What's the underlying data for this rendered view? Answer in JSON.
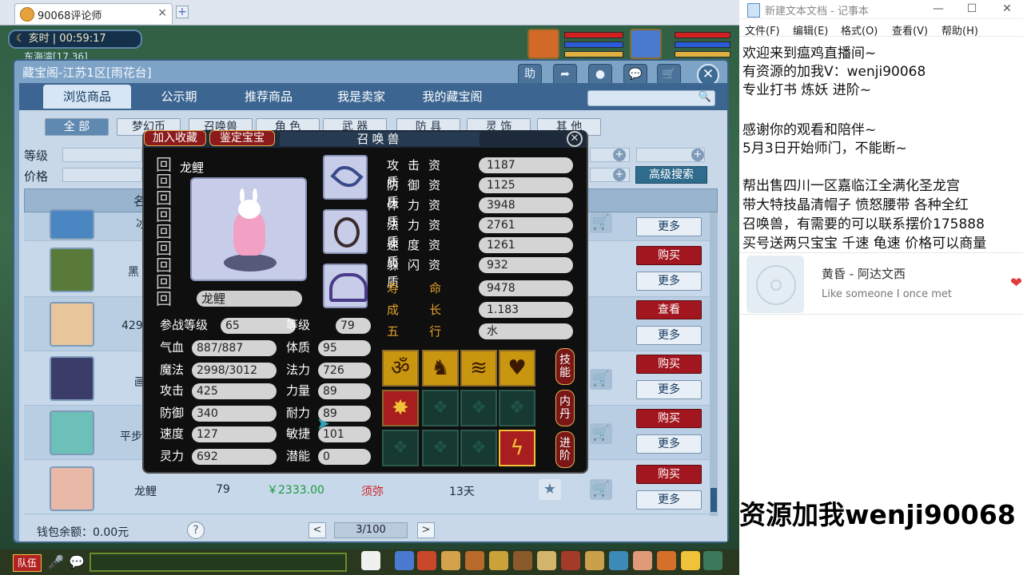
{
  "browser": {
    "tab_title": "90068评论师",
    "close": "×",
    "new_tab": "+"
  },
  "hud": {
    "clock": "亥时 | 00:59:17",
    "map": "东海湾[17,36]"
  },
  "dialog": {
    "title": "藏宝阁-江苏1区[雨花台]",
    "top_icons": {
      "help": "助",
      "share": "➦",
      "record": "●",
      "chat": "💬",
      "cart": "🛒"
    },
    "close": "✕",
    "tabs": [
      "浏览商品",
      "公示期",
      "推荐商品",
      "我是卖家",
      "我的藏宝阁"
    ],
    "categories": [
      "全 部",
      "梦幻币",
      "召唤兽",
      "角 色",
      "武 器",
      "防 具",
      "灵 饰",
      "其 他"
    ],
    "filter_level_label": "等级",
    "filter_price_label": "价格",
    "advanced_search": "高级搜索",
    "list_head_col": "名",
    "rows": [
      {
        "name": "冰",
        "level": "",
        "price": "",
        "server": "",
        "time": "",
        "btn1": "",
        "btn2": "更多"
      },
      {
        "name": "黑",
        "level": "",
        "price": "",
        "server": "",
        "time": "",
        "btn1": "购买",
        "btn2": "更多"
      },
      {
        "name": "",
        "level": "429",
        "price": "",
        "server": "",
        "time": "",
        "btn1": "查看",
        "btn2": "更多"
      },
      {
        "name": "画",
        "level": "",
        "price": "",
        "server": "",
        "time": "",
        "btn1": "购买",
        "btn2": "更多"
      },
      {
        "name": "平步",
        "level": "",
        "price": "",
        "server": "",
        "time": "",
        "btn1": "购买",
        "btn2": "更多"
      },
      {
        "name": "龙鲤",
        "level": "79",
        "price": "￥2333.00",
        "server": "须弥",
        "time": "13天",
        "btn1": "购买",
        "btn2": "更多"
      }
    ],
    "wallet": "钱包余额：0.00元",
    "help": "?",
    "prev": "<",
    "next": ">",
    "page": "3/100",
    "team": "队伍"
  },
  "pet": {
    "add_fav": "加入收藏",
    "appraise": "鉴定宝宝",
    "title": "召唤兽",
    "close": "✕",
    "name_top": "龙鲤",
    "name_box": "龙鲤",
    "stats_left": [
      {
        "label": "参战等级",
        "value": "65"
      },
      {
        "label": "气血",
        "value": "887/887"
      },
      {
        "label": "魔法",
        "value": "2998/3012"
      },
      {
        "label": "攻击",
        "value": "425"
      },
      {
        "label": "防御",
        "value": "340"
      },
      {
        "label": "速度",
        "value": "127"
      },
      {
        "label": "灵力",
        "value": "692"
      }
    ],
    "stats_right": [
      {
        "label": "等级",
        "value": "79"
      },
      {
        "label": "体质",
        "value": "95"
      },
      {
        "label": "法力",
        "value": "726"
      },
      {
        "label": "力量",
        "value": "89"
      },
      {
        "label": "耐力",
        "value": "89"
      },
      {
        "label": "敏捷",
        "value": "101"
      },
      {
        "label": "潜能",
        "value": "0"
      }
    ],
    "aptitudes": [
      {
        "label": "攻击资质",
        "value": "1187"
      },
      {
        "label": "防御资质",
        "value": "1125"
      },
      {
        "label": "体力资质",
        "value": "3948"
      },
      {
        "label": "法力资质",
        "value": "2761"
      },
      {
        "label": "速度资质",
        "value": "1261"
      },
      {
        "label": "躲闪资质",
        "value": "932"
      }
    ],
    "extra": [
      {
        "label": "寿        命",
        "value": "9478"
      },
      {
        "label": "成        长",
        "value": "1.183"
      },
      {
        "label": "五        行",
        "value": "水"
      }
    ],
    "side_buttons": [
      "技能",
      "内丹",
      "进阶"
    ]
  },
  "notepad": {
    "title": "新建文本文档 - 记事本",
    "menu": [
      "文件(F)",
      "编辑(E)",
      "格式(O)",
      "查看(V)",
      "帮助(H)"
    ],
    "lines_top": [
      "   欢迎来到瘟鸡直播间~",
      "有资源的加我V：wenji90068",
      "专业打书 炼妖 进阶~",
      "",
      "感谢你的观看和陪伴~",
      "5月3日开始师门，不能断~",
      "",
      "帮出售四川一区嘉临江全满化圣龙宫",
      "带大特技晶清帽子 愤怒腰带 各种全红",
      "召唤兽，有需要的可以联系摆价175888",
      "买号送两只宝宝 千速 龟速 价格可以商量"
    ],
    "music": {
      "song": "黄昏 - 阿达文西",
      "subtitle": "Like someone I once met"
    },
    "big_text": "资源加我wenji90068"
  }
}
